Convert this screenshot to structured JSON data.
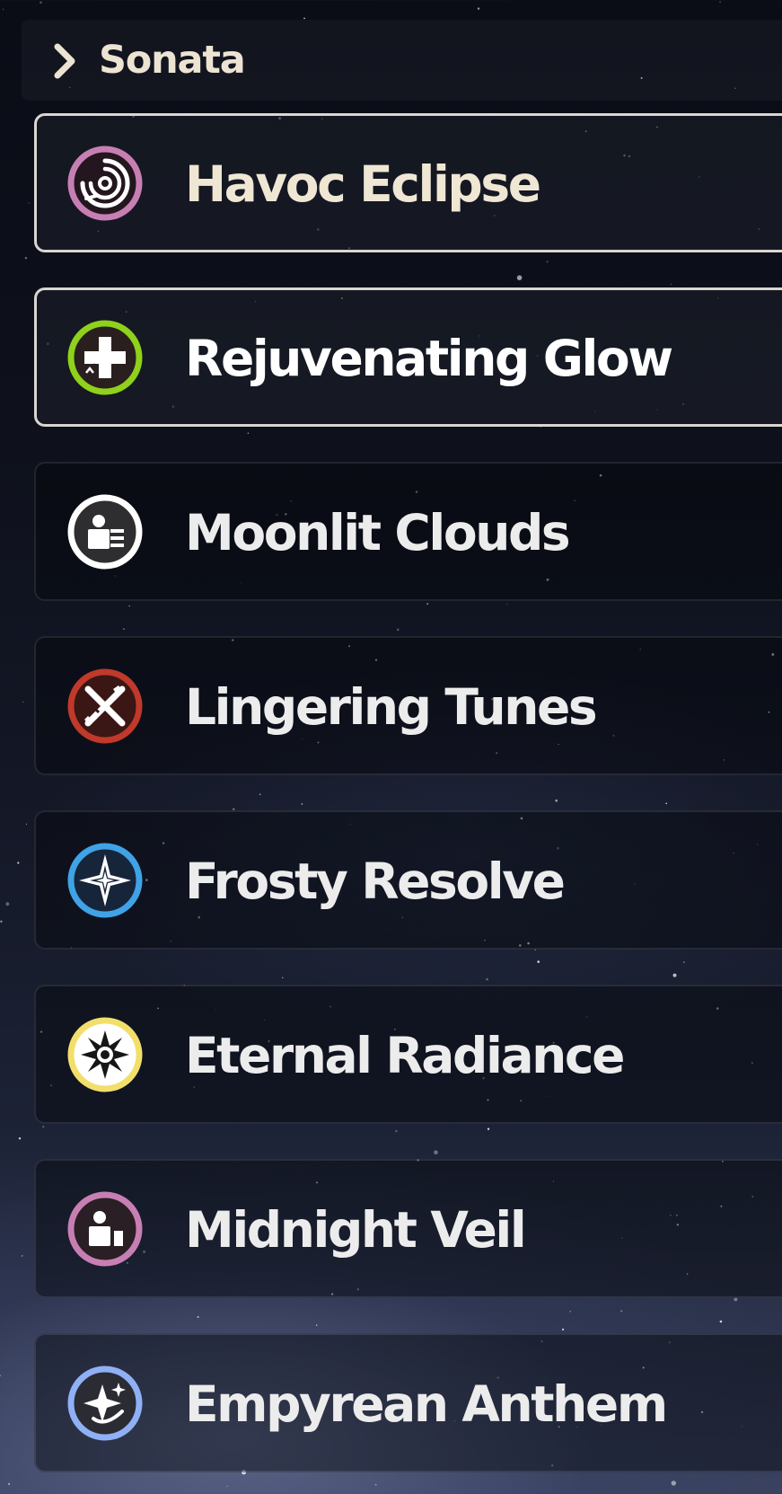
{
  "header": {
    "title": "Sonata",
    "icon": "chevron-right-icon"
  },
  "sonata_list": [
    {
      "label": "Havoc Eclipse",
      "icon": "havoc-spiral-icon",
      "ring_color": "#c77fb3",
      "label_color": "#efe6d4",
      "selected": true
    },
    {
      "label": "Rejuvenating Glow",
      "icon": "healing-cross-icon",
      "ring_color": "#8fd11b",
      "label_color": "#ffffff",
      "selected": true
    },
    {
      "label": "Moonlit Clouds",
      "icon": "moonlit-id-card-icon",
      "ring_color": "#ffffff",
      "label_color": "#ececec",
      "selected": false
    },
    {
      "label": "Lingering Tunes",
      "icon": "crossed-swords-icon",
      "ring_color": "#c0392b",
      "label_color": "#ececec",
      "selected": false
    },
    {
      "label": "Frosty Resolve",
      "icon": "glacio-star-icon",
      "ring_color": "#3fa3e6",
      "label_color": "#ececec",
      "selected": false
    },
    {
      "label": "Eternal Radiance",
      "icon": "spectro-sun-icon",
      "ring_color": "#f2df6b",
      "label_color": "#ececec",
      "selected": false
    },
    {
      "label": "Midnight Veil",
      "icon": "midnight-figure-icon",
      "ring_color": "#c77fb3",
      "label_color": "#ececec",
      "selected": false
    },
    {
      "label": "Empyrean Anthem",
      "icon": "empyrean-sparkle-icon",
      "ring_color": "#8fb0f5",
      "label_color": "#ececec",
      "selected": false
    }
  ]
}
